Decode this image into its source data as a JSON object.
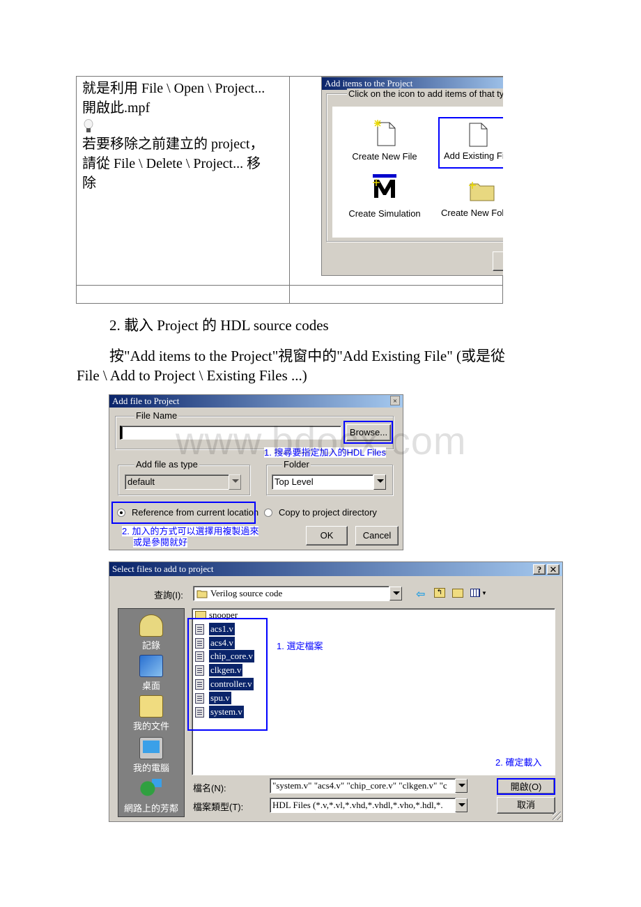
{
  "table": {
    "left_cell_lines": [
      "就是利用 File \\ Open \\ Project...",
      "開啟此.mpf",
      "若要移除之前建立的 project，",
      "請從 File \\ Delete \\ Project... 移",
      "除"
    ],
    "tip_icon": "lightbulb-icon"
  },
  "add_items_dialog": {
    "title": "Add items to the Project",
    "group_label": "Click on the icon to add items of that type",
    "items": [
      {
        "label": "Create New File",
        "icon": "new-file-icon"
      },
      {
        "label": "Add Existing File",
        "icon": "file-icon",
        "highlighted": true
      },
      {
        "label": "Create Simulation",
        "icon": "modelsim-icon"
      },
      {
        "label": "Create New Folder",
        "icon": "new-folder-icon"
      }
    ]
  },
  "section": {
    "heading": "2. 載入 Project 的 HDL source codes",
    "para_line1": "按\"Add items to the Project\"視窗中的\"Add Existing File\" (或是從",
    "para_line2": "File \\ Add to Project \\ Existing Files ...)"
  },
  "add_file_dialog": {
    "title": "Add file to Project",
    "file_name_label": "File Name",
    "file_name_value": "",
    "browse_label": "Browse...",
    "annotation1": "1. 搜尋要指定加入的HDL Files",
    "type_label": "Add file as type",
    "type_value": "default",
    "folder_label": "Folder",
    "folder_value": "Top Level",
    "radio_reference": "Reference from current location",
    "radio_copy": "Copy to project directory",
    "annotation2_line1": "2. 加入的方式可以選擇用複製過來",
    "annotation2_line2": "或是參閱就好",
    "ok_label": "OK",
    "cancel_label": "Cancel"
  },
  "watermark": "www.bdocx.com",
  "select_files_dialog": {
    "title": "Select files to add to project",
    "help_label": "?",
    "close_label": "✕",
    "look_in_label": "查詢(I):",
    "look_in_value": "Verilog source code",
    "places": [
      "記錄",
      "桌面",
      "我的文件",
      "我的電腦",
      "網路上的芳鄰"
    ],
    "folder_item": "snooper",
    "files": [
      "acs1.v",
      "acs4.v",
      "chip_core.v",
      "clkgen.v",
      "controller.v",
      "spu.v",
      "system.v"
    ],
    "annotation1": "1. 選定檔案",
    "annotation2": "2. 確定載入",
    "file_name_label": "檔名(N):",
    "file_name_value": "\"system.v\" \"acs4.v\" \"chip_core.v\" \"clkgen.v\" \"c",
    "file_type_label": "檔案類型(T):",
    "file_type_value": "HDL Files (*.v,*.vl,*.vhd,*.vhdl,*.vho,*.hdl,*.",
    "open_label": "開啟(O)",
    "cancel_label": "取消"
  }
}
